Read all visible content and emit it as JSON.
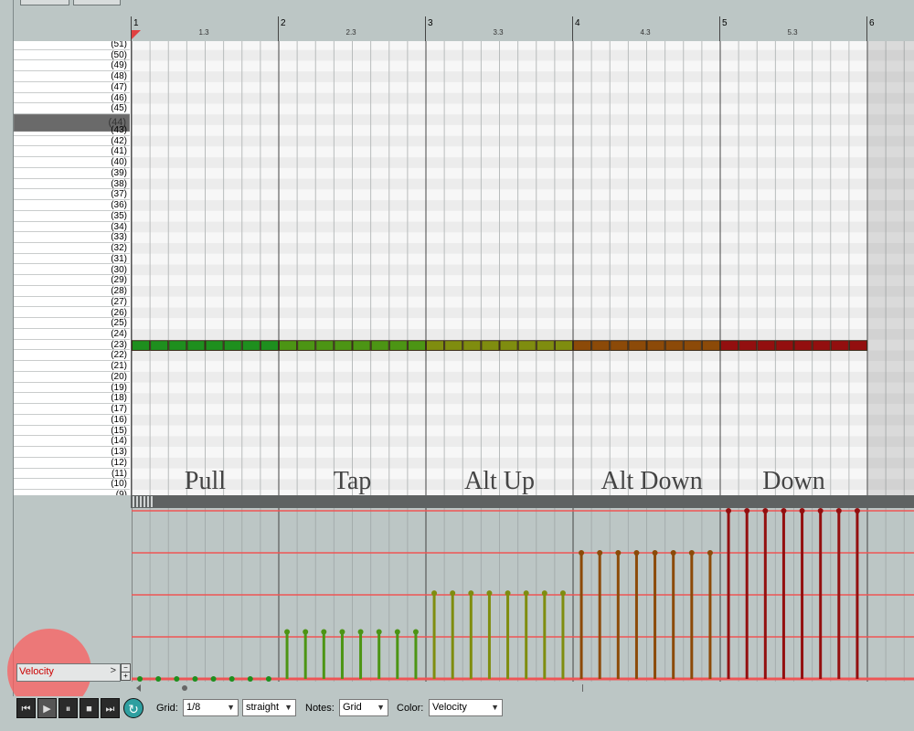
{
  "ruler": {
    "bars": [
      "1",
      "2",
      "3",
      "4",
      "5",
      "6"
    ],
    "sub_labels": [
      "1.3",
      "2.3",
      "3.3",
      "4.3",
      "5.3"
    ]
  },
  "piano_roll": {
    "rows": [
      "(51)",
      "(50)",
      "(49)",
      "(48)",
      "(47)",
      "(46)",
      "(45)",
      "(44)",
      "(43)",
      "(42)",
      "(41)",
      "(40)",
      "(39)",
      "(38)",
      "(37)",
      "(36)",
      "(35)",
      "(34)",
      "(33)",
      "(32)",
      "(31)",
      "(30)",
      "(29)",
      "(28)",
      "(27)",
      "(26)",
      "(25)",
      "(24)",
      "(23)",
      "(22)",
      "(21)",
      "(20)",
      "(19)",
      "(18)",
      "(17)",
      "(16)",
      "(15)",
      "(14)",
      "(13)",
      "(12)",
      "(11)",
      "(10)",
      "(9)"
    ],
    "selected_row": "(44)",
    "note_row": "(23)",
    "note_count": 40,
    "colors": {
      "pull": "#1e8f1e",
      "tap": "#4c9514",
      "alt_up": "#7f8d0f",
      "alt_down": "#8c4a08",
      "down": "#930f0f",
      "note_border": "#3a2a1a"
    }
  },
  "sections": [
    {
      "label": "Pull",
      "velocity": 0.0
    },
    {
      "label": "Tap",
      "velocity": 0.28
    },
    {
      "label": "Alt Up",
      "velocity": 0.51
    },
    {
      "label": "Alt Down",
      "velocity": 0.75
    },
    {
      "label": "Down",
      "velocity": 1.0
    }
  ],
  "lane": {
    "selector": "Velocity",
    "arrow": ">"
  },
  "toolbar": {
    "grid_label": "Grid:",
    "grid_value": "1/8",
    "swing_value": "straight",
    "notes_label": "Notes:",
    "notes_value": "Grid",
    "color_label": "Color:",
    "color_value": "Velocity"
  },
  "icons": {
    "skip_start": "⏮",
    "play": "▶",
    "pause": "⏸",
    "stop": "■",
    "skip_end": "⏭",
    "loop": "↻"
  }
}
